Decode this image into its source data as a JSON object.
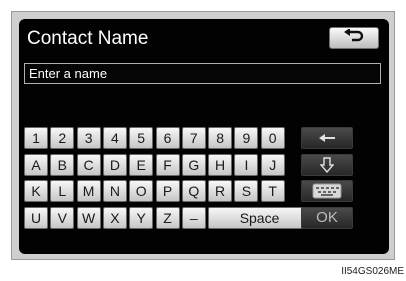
{
  "screen": {
    "title": "Contact Name",
    "back_icon": "return-arrow-icon",
    "input": {
      "placeholder": "Enter a name",
      "value": ""
    }
  },
  "keyboard": {
    "rows": [
      [
        "1",
        "2",
        "3",
        "4",
        "5",
        "6",
        "7",
        "8",
        "9",
        "0"
      ],
      [
        "A",
        "B",
        "C",
        "D",
        "E",
        "F",
        "G",
        "H",
        "I",
        "J"
      ],
      [
        "K",
        "L",
        "M",
        "N",
        "O",
        "P",
        "Q",
        "R",
        "S",
        "T"
      ],
      [
        "U",
        "V",
        "W",
        "X",
        "Y",
        "Z",
        "–"
      ]
    ],
    "space_label": "Space",
    "ok_label": "OK",
    "side_icons": [
      "backspace-arrow-icon",
      "down-arrow-icon",
      "keyboard-layout-icon"
    ]
  },
  "caption": "II54GS026ME",
  "colors": {
    "screen": "#020202",
    "key_light": "#e6e6e6",
    "key_dark": "#333333"
  }
}
